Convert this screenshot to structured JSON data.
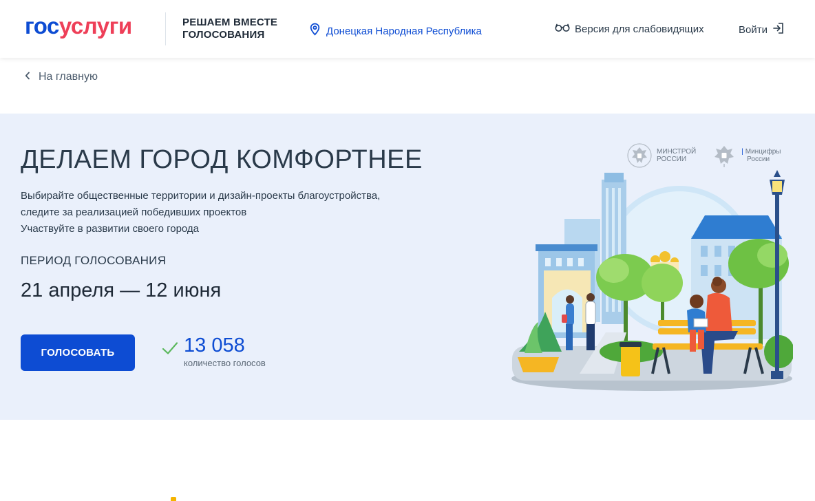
{
  "header": {
    "logo_part1": "гос",
    "logo_part2": "услуги",
    "project_line1": "РЕШАЕМ ВМЕСТЕ",
    "project_line2": "ГОЛОСОВАНИЯ",
    "region": "Донецкая Народная Республика",
    "region_icon": "location-pin-icon",
    "accessibility": "Версия для слабовидящих",
    "accessibility_icon": "glasses-icon",
    "login": "Войти",
    "login_icon": "login-arrow-icon"
  },
  "breadcrumb": {
    "back_label": "На главную",
    "back_icon": "chevron-left-icon"
  },
  "hero": {
    "title": "ДЕЛАЕМ ГОРОД КОМФОРТНЕЕ",
    "description_line1": "Выбирайте общественные территории и дизайн-проекты благоустройства,",
    "description_line2": "следите за реализацией победивших проектов",
    "description_line3": "Участвуйте в развитии своего города",
    "period_label": "ПЕРИОД ГОЛОСОВАНИЯ",
    "period_value": "21 апреля — 12 июня",
    "vote_button": "ГОЛОСОВАТЬ",
    "votes_count": "13 058",
    "votes_label": "количество голосов",
    "check_icon": "checkmark-icon",
    "ministry1_line1": "МИНСТРОЙ",
    "ministry1_line2": "РОССИИ",
    "ministry2_line1": "Минцифры",
    "ministry2_line2": "России"
  },
  "colors": {
    "brand_blue": "#0d4cd3",
    "brand_red": "#ee3f58",
    "hero_bg": "#eaf0fb",
    "check_green": "#5bb85c"
  }
}
